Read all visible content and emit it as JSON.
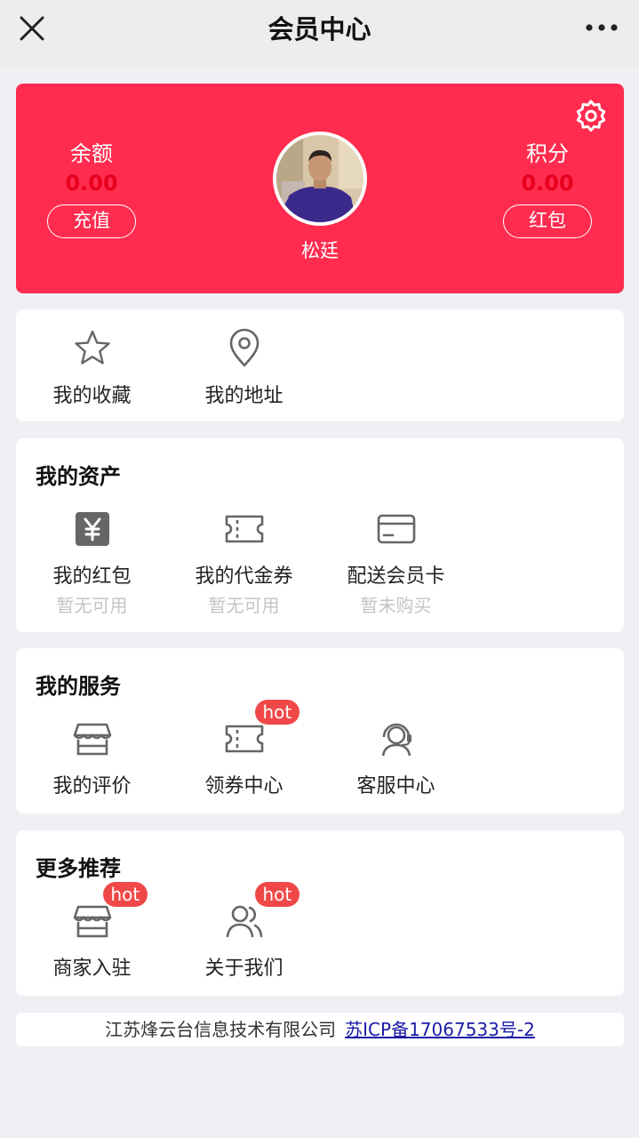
{
  "header": {
    "title": "会员中心"
  },
  "hero": {
    "balance_label": "余额",
    "balance_value": "0.00",
    "recharge_label": "充值",
    "points_label": "积分",
    "points_value": "0.00",
    "redpacket_label": "红包",
    "username": "松廷"
  },
  "quick": [
    {
      "label": "我的收藏",
      "icon": "star-icon"
    },
    {
      "label": "我的地址",
      "icon": "location-pin-icon"
    }
  ],
  "assets": {
    "title": "我的资产",
    "items": [
      {
        "label": "我的红包",
        "sub": "暂无可用",
        "icon": "yen-icon"
      },
      {
        "label": "我的代金券",
        "sub": "暂无可用",
        "icon": "ticket-icon"
      },
      {
        "label": "配送会员卡",
        "sub": "暂未购买",
        "icon": "card-icon"
      }
    ]
  },
  "services": {
    "title": "我的服务",
    "items": [
      {
        "label": "我的评价",
        "icon": "store-icon"
      },
      {
        "label": "领券中心",
        "icon": "ticket-icon",
        "badge": "hot"
      },
      {
        "label": "客服中心",
        "icon": "headset-icon"
      }
    ]
  },
  "more": {
    "title": "更多推荐",
    "items": [
      {
        "label": "商家入驻",
        "icon": "store-icon",
        "badge": "hot"
      },
      {
        "label": "关于我们",
        "icon": "users-icon",
        "badge": "hot"
      }
    ]
  },
  "footer": {
    "company": "江苏烽云台信息技术有限公司",
    "icp": "苏ICP备17067533号-2"
  },
  "colors": {
    "hero_bg": "#ff2c4f",
    "value_red": "#e8001c",
    "hot_badge": "#f04848",
    "link": "#1a1aa6"
  }
}
